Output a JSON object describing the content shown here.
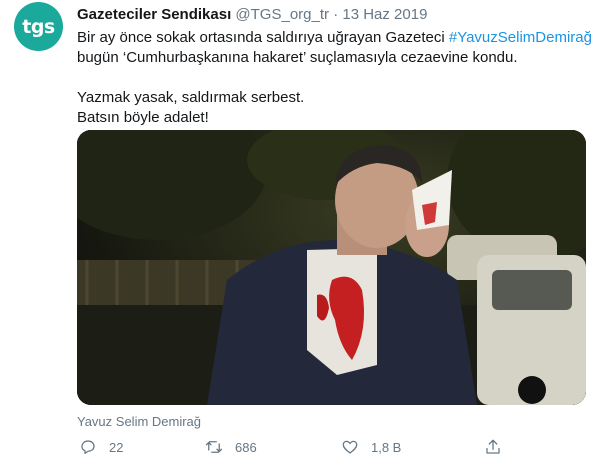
{
  "tweet": {
    "avatar_text": "tgs",
    "avatar_color": "#1aa99b",
    "author_name": "Gazeteciler Sendikası",
    "handle": "@TGS_org_tr",
    "separator": "·",
    "date": "13 Haz 2019",
    "text_line1_pre": "Bir ay önce sokak ortasında saldırıya uğrayan Gazeteci ",
    "hashtag": "#YavuzSelimDemirağ",
    "text_line2": "bugün ‘Cumhurbaşkanına hakaret’ suçlamasıyla cezaevine kondu.",
    "text_line3": "Yazmak yasak, saldırmak serbest.",
    "text_line4": "Batsın böyle adalet!",
    "media_credit": "Yavuz Selim Demirağ",
    "accent_color": "#1b95e0"
  },
  "actions": {
    "reply": {
      "icon": "reply-icon",
      "count": "22"
    },
    "retweet": {
      "icon": "retweet-icon",
      "count": "686"
    },
    "like": {
      "icon": "heart-icon",
      "count": "1,8 B"
    },
    "share": {
      "icon": "share-icon"
    }
  }
}
